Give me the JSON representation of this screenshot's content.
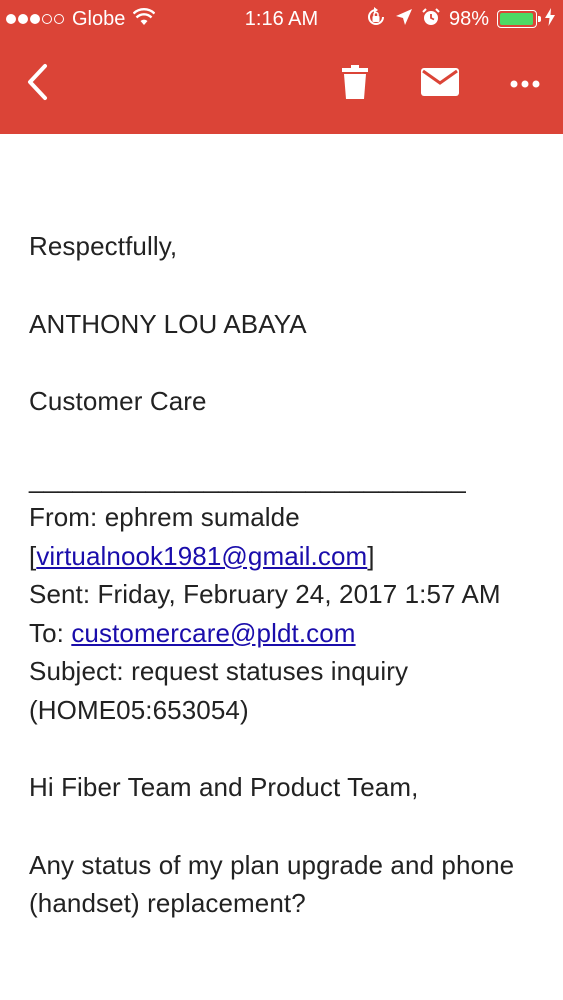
{
  "status_bar": {
    "carrier": "Globe",
    "time": "1:16 AM",
    "battery_percent": "98%",
    "battery_level": 0.98,
    "signal_bars_filled": 3,
    "signal_bars_total": 5,
    "icons": [
      "wifi-icon",
      "rotation-lock-icon",
      "location-arrow-icon",
      "alarm-icon",
      "charging-bolt-icon"
    ]
  },
  "toolbar": {
    "background_color": "#db4437",
    "buttons": [
      "back-arrow-icon",
      "trash-icon",
      "mail-icon",
      "more-options-icon"
    ]
  },
  "email": {
    "closing": "Respectfully,",
    "sender_name": "ANTHONY LOU ABAYA",
    "sender_dept": "Customer Care",
    "divider": "______________________________",
    "from_prefix": "From: ephrem sumalde",
    "from_bracket_open": "[",
    "from_email": "virtualnook1981@gmail.com",
    "from_bracket_close": "]",
    "sent": "Sent: Friday, February 24, 2017 1:57 AM",
    "to_prefix": "To: ",
    "to_email": "customercare@pldt.com",
    "subject": "Subject: request statuses inquiry (HOME05:653054)",
    "greeting": "Hi Fiber Team and Product Team,",
    "body": "Any status of my plan upgrade and phone (handset) replacement?"
  }
}
